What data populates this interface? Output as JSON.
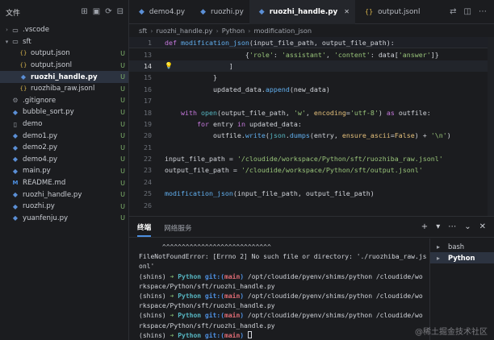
{
  "sidebar": {
    "title": "文件",
    "tools": [
      "new-file-icon",
      "new-folder-icon",
      "refresh-icon",
      "collapse-icon"
    ],
    "items": [
      {
        "label": ".vscode",
        "type": "folder",
        "expanded": false,
        "depth": 0,
        "status": ""
      },
      {
        "label": "sft",
        "type": "folder",
        "expanded": true,
        "depth": 0,
        "status": ""
      },
      {
        "label": "output.json",
        "type": "json",
        "depth": 1,
        "status": "U"
      },
      {
        "label": "output.jsonl",
        "type": "json",
        "depth": 1,
        "status": "U"
      },
      {
        "label": "ruozhi_handle.py",
        "type": "py",
        "depth": 1,
        "status": "U",
        "selected": true
      },
      {
        "label": "ruozhiba_raw.jsonl",
        "type": "json",
        "depth": 1,
        "status": "U"
      },
      {
        "label": ".gitignore",
        "type": "dot",
        "depth": 0,
        "status": "U"
      },
      {
        "label": "bubble_sort.py",
        "type": "py",
        "depth": 0,
        "status": "U"
      },
      {
        "label": "demo",
        "type": "file",
        "depth": 0,
        "status": "U"
      },
      {
        "label": "demo1.py",
        "type": "py",
        "depth": 0,
        "status": "U"
      },
      {
        "label": "demo2.py",
        "type": "py",
        "depth": 0,
        "status": "U"
      },
      {
        "label": "demo4.py",
        "type": "py",
        "depth": 0,
        "status": "U"
      },
      {
        "label": "main.py",
        "type": "py",
        "depth": 0,
        "status": "U"
      },
      {
        "label": "README.md",
        "type": "md",
        "depth": 0,
        "status": "U"
      },
      {
        "label": "ruozhi_handle.py",
        "type": "py",
        "depth": 0,
        "status": "U"
      },
      {
        "label": "ruozhi.py",
        "type": "py",
        "depth": 0,
        "status": "U"
      },
      {
        "label": "yuanfenju.py",
        "type": "py",
        "depth": 0,
        "status": "U"
      }
    ]
  },
  "tabs": [
    {
      "label": "demo4.py",
      "type": "py",
      "active": false
    },
    {
      "label": "ruozhi.py",
      "type": "py",
      "active": false
    },
    {
      "label": "ruozhi_handle.py",
      "type": "py",
      "active": true
    },
    {
      "label": "output.jsonl",
      "type": "json",
      "active": false
    }
  ],
  "tab_tools": [
    "diff-icon",
    "split-editor-icon",
    "more-icon"
  ],
  "breadcrumb": [
    "sft",
    "ruozhi_handle.py",
    "Python",
    "modification_json"
  ],
  "editor": {
    "sticky_line": {
      "num": "1",
      "text": "def modification_json(input_file_path, output_file_path):"
    },
    "lines": [
      {
        "num": "13",
        "text": "                    {'role': 'assistant', 'content': data['answer']}"
      },
      {
        "num": "14",
        "text": "                ]",
        "current": true
      },
      {
        "num": "15",
        "text": "            }"
      },
      {
        "num": "16",
        "text": "            updated_data.append(new_data)"
      },
      {
        "num": "17",
        "text": ""
      },
      {
        "num": "18",
        "text": "    with open(output_file_path, 'w', encoding='utf-8') as outfile:"
      },
      {
        "num": "19",
        "text": "        for entry in updated_data:"
      },
      {
        "num": "20",
        "text": "            outfile.write(json.dumps(entry, ensure_ascii=False) + '\\n')"
      },
      {
        "num": "21",
        "text": ""
      },
      {
        "num": "22",
        "text": "input_file_path = '/cloudide/workspace/Python/sft/ruozhiba_raw.jsonl'"
      },
      {
        "num": "23",
        "text": "output_file_path = '/cloudide/workspace/Python/sft/output.jsonl'"
      },
      {
        "num": "24",
        "text": ""
      },
      {
        "num": "25",
        "text": "modification_json(input_file_path, output_file_path)"
      },
      {
        "num": "26",
        "text": ""
      }
    ]
  },
  "panel": {
    "tabs": [
      {
        "label": "终端",
        "active": true
      },
      {
        "label": "网络服务",
        "active": false
      }
    ],
    "tools": [
      "+",
      "▾",
      "⋯",
      "⌄",
      "✕"
    ],
    "terminal_lines": [
      {
        "kind": "plain",
        "text": "      ^^^^^^^^^^^^^^^^^^^^^^^^^^^^"
      },
      {
        "kind": "plain",
        "text": "FileNotFoundError: [Errno 2] No such file or directory: './ruozhiba_raw.js"
      },
      {
        "kind": "plain",
        "text": "onl'"
      },
      {
        "kind": "prompt",
        "env": "(shins)",
        "arrow": "➜",
        "dir": "Python",
        "git": "git:(",
        "branch": "main",
        "git_end": ")",
        "cmd": " /opt/cloudide/pyenv/shims/python /cloudide/wo"
      },
      {
        "kind": "plain",
        "text": "rkspace/Python/sft/ruozhi_handle.py"
      },
      {
        "kind": "prompt",
        "env": "(shins)",
        "arrow": "➜",
        "dir": "Python",
        "git": "git:(",
        "branch": "main",
        "git_end": ")",
        "cmd": " /opt/cloudide/pyenv/shims/python /cloudide/wo"
      },
      {
        "kind": "plain",
        "text": "rkspace/Python/sft/ruozhi_handle.py"
      },
      {
        "kind": "prompt",
        "env": "(shins)",
        "arrow": "➜",
        "dir": "Python",
        "git": "git:(",
        "branch": "main",
        "git_end": ")",
        "cmd": " /opt/cloudide/pyenv/shims/python /cloudide/wo"
      },
      {
        "kind": "plain",
        "text": "rkspace/Python/sft/ruozhi_handle.py"
      },
      {
        "kind": "prompt",
        "env": "(shins)",
        "arrow": "➜",
        "dir": "Python",
        "git": "git:(",
        "branch": "main",
        "git_end": ")",
        "cmd": " ",
        "cursor": true
      }
    ],
    "shells": [
      {
        "label": "bash",
        "active": false
      },
      {
        "label": "Python",
        "active": true
      }
    ]
  },
  "watermark": "@稀土掘金技术社区"
}
